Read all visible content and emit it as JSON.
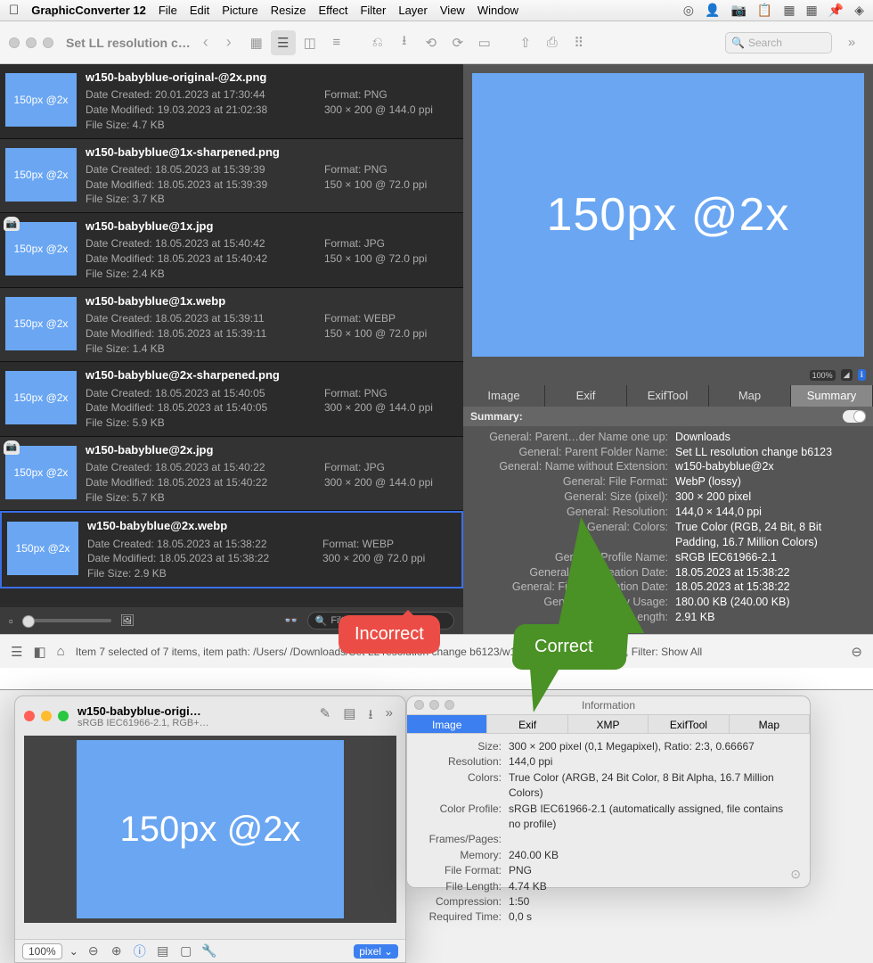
{
  "menubar": {
    "app": "GraphicConverter 12",
    "items": [
      "File",
      "Edit",
      "Picture",
      "Resize",
      "Effect",
      "Filter",
      "Layer",
      "View",
      "Window"
    ]
  },
  "browser": {
    "title": "Set LL resolution c…",
    "search_placeholder": "Search",
    "thumb_label": "150px @2x",
    "big_preview": "150px @2x",
    "filter_placeholder": "Filter",
    "files": [
      {
        "name": "w150-babyblue-original-@2x.png",
        "created": "Date Created: 20.01.2023 at 17:30:44",
        "modified": "Date Modified: 19.03.2023 at 21:02:38",
        "size": "File Size: 4.7 KB",
        "format": "Format: PNG",
        "dims": "300 × 200 @ 144.0 ppi",
        "cam": false
      },
      {
        "name": "w150-babyblue@1x-sharpened.png",
        "created": "Date Created: 18.05.2023 at 15:39:39",
        "modified": "Date Modified: 18.05.2023 at 15:39:39",
        "size": "File Size: 3.7 KB",
        "format": "Format: PNG",
        "dims": "150 × 100 @ 72.0 ppi",
        "cam": false
      },
      {
        "name": "w150-babyblue@1x.jpg",
        "created": "Date Created: 18.05.2023 at 15:40:42",
        "modified": "Date Modified: 18.05.2023 at 15:40:42",
        "size": "File Size: 2.4 KB",
        "format": "Format: JPG",
        "dims": "150 × 100 @ 72.0 ppi",
        "cam": true
      },
      {
        "name": "w150-babyblue@1x.webp",
        "created": "Date Created: 18.05.2023 at 15:39:11",
        "modified": "Date Modified: 18.05.2023 at 15:39:11",
        "size": "File Size: 1.4 KB",
        "format": "Format: WEBP",
        "dims": "150 × 100 @ 72.0 ppi",
        "cam": false
      },
      {
        "name": "w150-babyblue@2x-sharpened.png",
        "created": "Date Created: 18.05.2023 at 15:40:05",
        "modified": "Date Modified: 18.05.2023 at 15:40:05",
        "size": "File Size: 5.9 KB",
        "format": "Format: PNG",
        "dims": "300 × 200 @ 144.0 ppi",
        "cam": false
      },
      {
        "name": "w150-babyblue@2x.jpg",
        "created": "Date Created: 18.05.2023 at 15:40:22",
        "modified": "Date Modified: 18.05.2023 at 15:40:22",
        "size": "File Size: 5.7 KB",
        "format": "Format: JPG",
        "dims": "300 × 200 @ 144.0 ppi",
        "cam": true
      },
      {
        "name": "w150-babyblue@2x.webp",
        "created": "Date Created: 18.05.2023 at 15:38:22",
        "modified": "Date Modified: 18.05.2023 at 15:38:22",
        "size": "File Size: 2.9 KB",
        "format": "Format: WEBP",
        "dims": "300 × 200 @ 72.0 ppi",
        "cam": false
      }
    ],
    "selected_index": 6,
    "tabs": [
      "Image",
      "Exif",
      "ExifTool",
      "Map",
      "Summary"
    ],
    "active_tab": 4,
    "summary_label": "Summary:",
    "summary": [
      {
        "k": "General: Parent…der Name one up:",
        "v": "Downloads"
      },
      {
        "k": "General: Parent Folder Name:",
        "v": "Set LL resolution change b6123"
      },
      {
        "k": "General: Name without Extension:",
        "v": "w150-babyblue@2x"
      },
      {
        "k": "General: File Format:",
        "v": "WebP (lossy)"
      },
      {
        "k": "General: Size (pixel):",
        "v": "300 × 200 pixel"
      },
      {
        "k": "General: Resolution:",
        "v": "144,0 × 144,0 ppi"
      },
      {
        "k": "General: Colors:",
        "v": "True Color (RGB, 24 Bit, 8 Bit Padding, 16.7 Million Colors)"
      },
      {
        "k": "General: Profile Name:",
        "v": "sRGB IEC61966-2.1"
      },
      {
        "k": "General: File Creation Date:",
        "v": "18.05.2023 at 15:38:22"
      },
      {
        "k": "General: File Modification Date:",
        "v": "18.05.2023 at 15:38:22"
      },
      {
        "k": "General: Memory Usage:",
        "v": "180.00 KB (240.00 KB)"
      },
      {
        "k": "General: File Length:",
        "v": "2.91 KB"
      }
    ],
    "status": "Item 7 selected of 7 items, item path: /Users/    /Downloads/Set LL resolution change b6123/w150-babyblue@2x.webp, Filter: Show All"
  },
  "imgwin": {
    "title": "w150-babyblue-origi…",
    "subtitle": "sRGB IEC61966-2.1, RGB+…",
    "label": "150px @2x",
    "zoom": "100%",
    "unit": "pixel"
  },
  "infowin": {
    "title": "Information",
    "tabs": [
      "Image",
      "Exif",
      "XMP",
      "ExifTool",
      "Map"
    ],
    "active": 0,
    "rows": [
      {
        "k": "Size:",
        "v": "300 × 200 pixel (0,1 Megapixel), Ratio: 2:3, 0.66667"
      },
      {
        "k": "Resolution:",
        "v": "144,0 ppi"
      },
      {
        "k": "Colors:",
        "v": "True Color (ARGB, 24 Bit Color, 8 Bit Alpha, 16.7 Million Colors)"
      },
      {
        "k": "Color Profile:",
        "v": "sRGB IEC61966-2.1 (automatically assigned, file contains no profile)"
      },
      {
        "k": "Frames/Pages:",
        "v": ""
      },
      {
        "k": "Memory:",
        "v": "240.00 KB"
      },
      {
        "k": "File Format:",
        "v": "PNG"
      },
      {
        "k": "File Length:",
        "v": "4.74 KB"
      },
      {
        "k": "Compression:",
        "v": "1:50"
      },
      {
        "k": "Required Time:",
        "v": "0,0 s"
      }
    ]
  },
  "annotations": {
    "incorrect": "Incorrect",
    "correct": "Correct"
  }
}
